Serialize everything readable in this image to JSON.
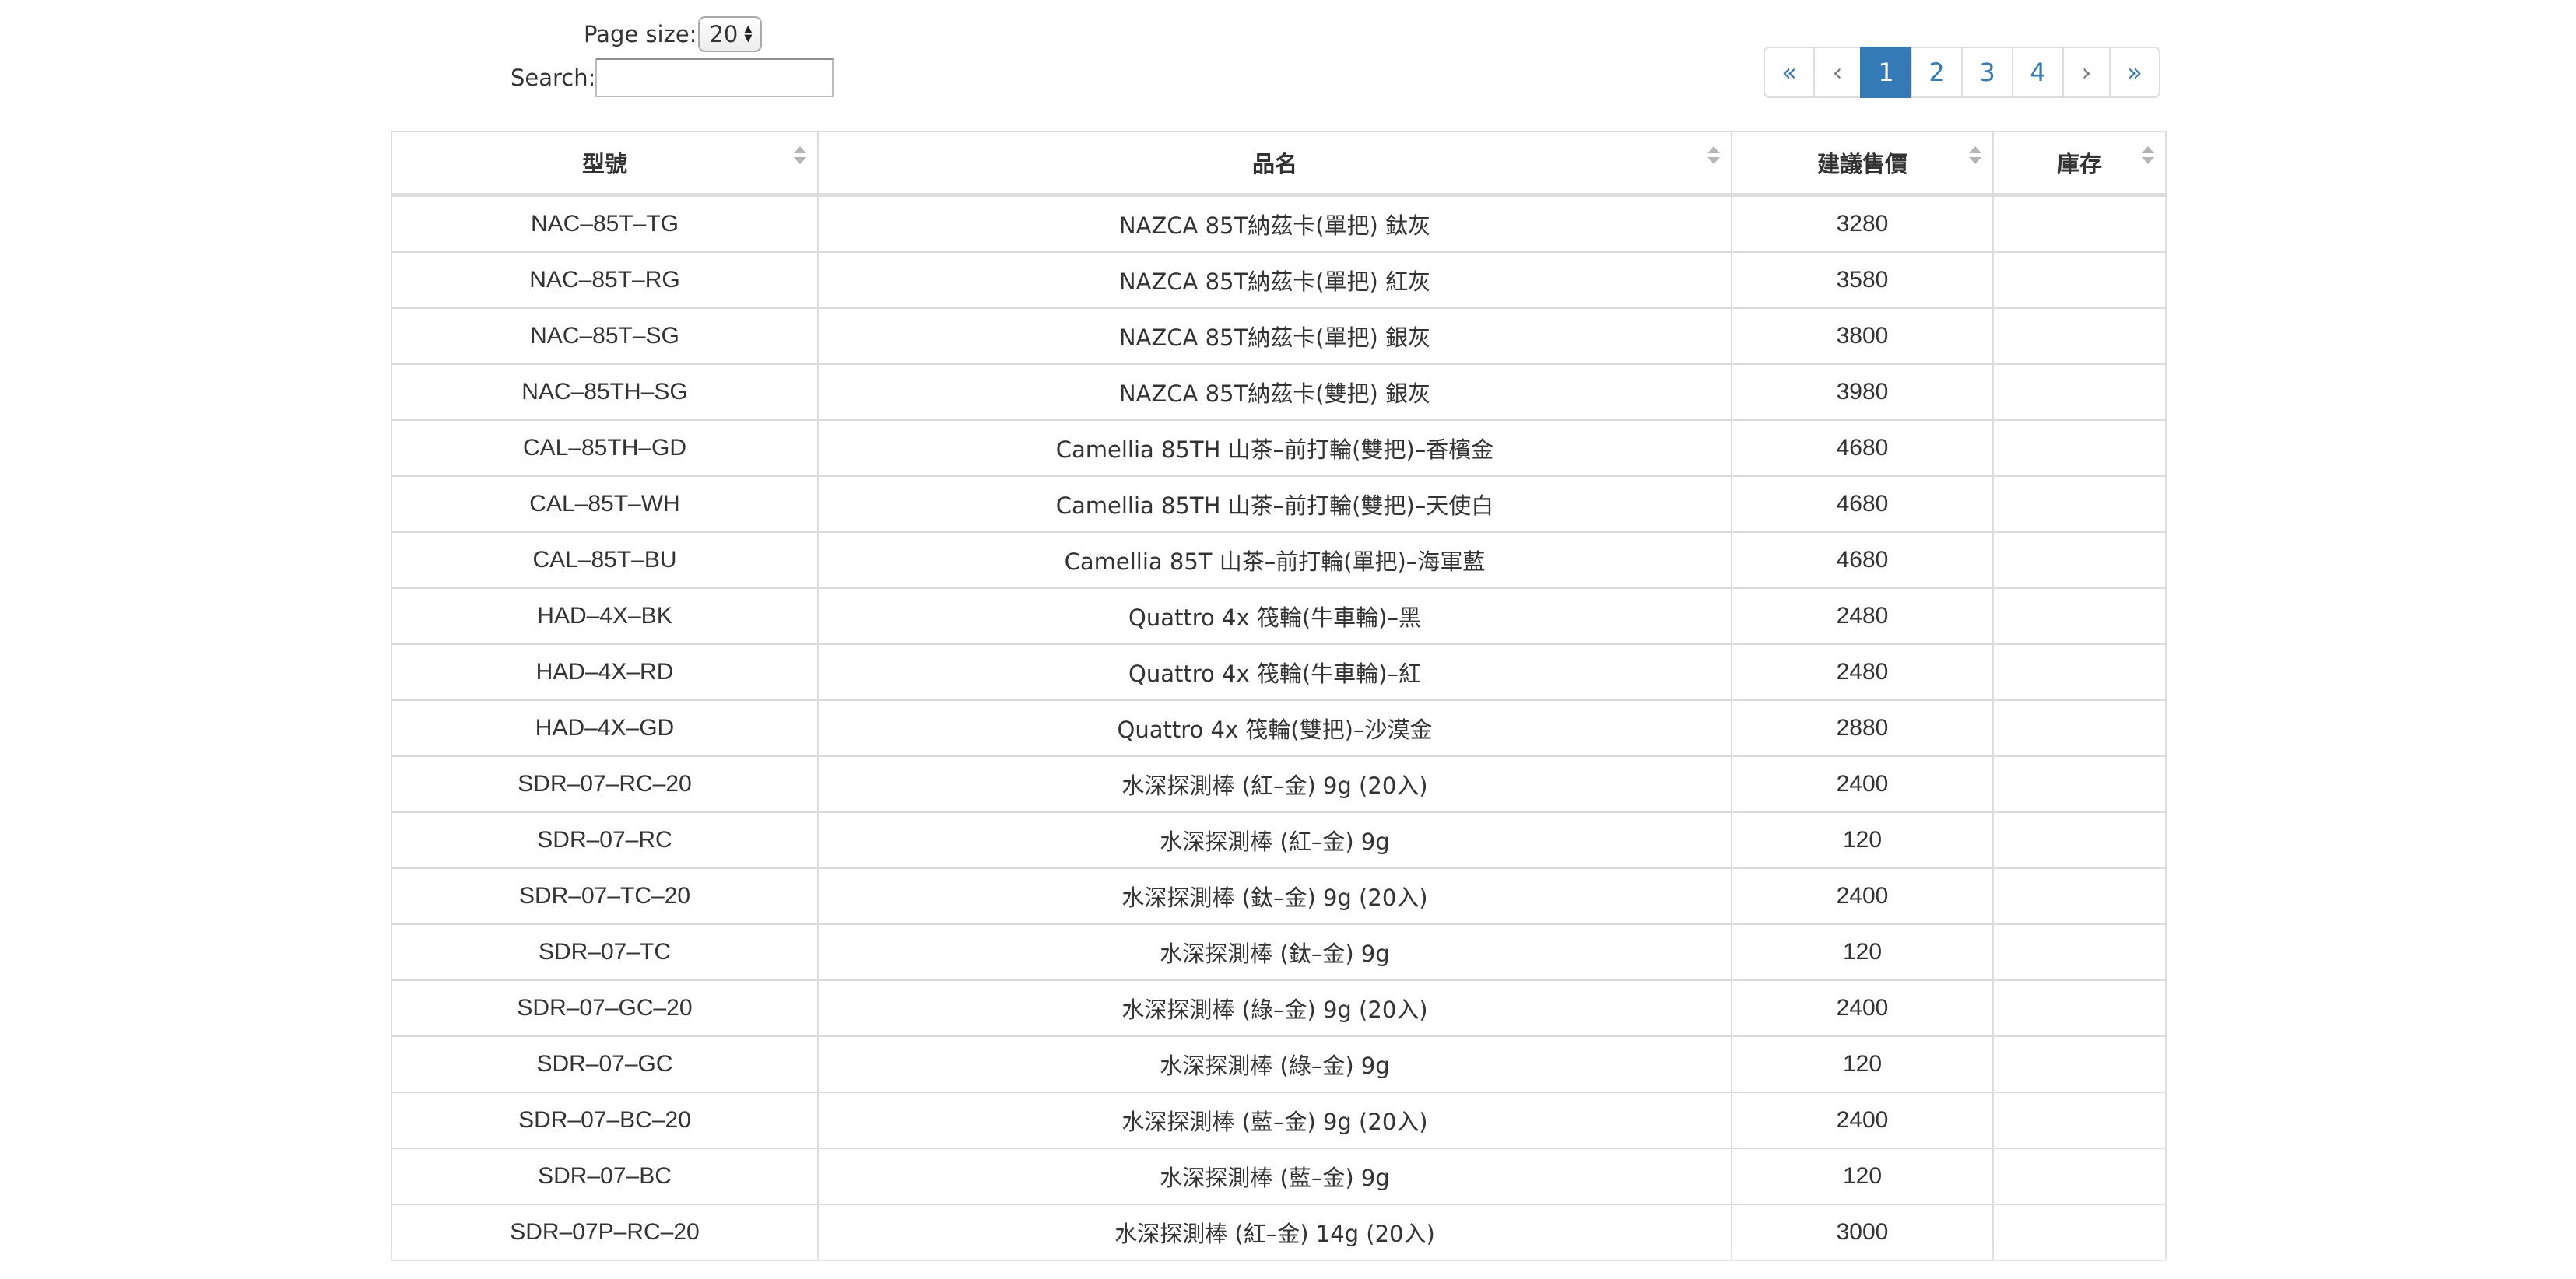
{
  "controls": {
    "page_size_label": "Page size:",
    "page_size_value": "20",
    "search_label": "Search:",
    "search_value": ""
  },
  "pagination": {
    "first": "«",
    "prev": "‹",
    "pages": [
      "1",
      "2",
      "3",
      "4"
    ],
    "active_page": "1",
    "next": "›",
    "last": "»"
  },
  "table": {
    "headers": [
      "型號",
      "品名",
      "建議售價",
      "庫存"
    ],
    "rows": [
      [
        "NAC–85T–TG",
        "NAZCA 85T納茲卡(單把) 鈦灰",
        "3280",
        ""
      ],
      [
        "NAC–85T–RG",
        "NAZCA 85T納茲卡(單把) 紅灰",
        "3580",
        ""
      ],
      [
        "NAC–85T–SG",
        "NAZCA 85T納茲卡(單把) 銀灰",
        "3800",
        ""
      ],
      [
        "NAC–85TH–SG",
        "NAZCA 85T納茲卡(雙把) 銀灰",
        "3980",
        ""
      ],
      [
        "CAL–85TH–GD",
        "Camellia 85TH 山茶–前打輪(雙把)–香檳金",
        "4680",
        ""
      ],
      [
        "CAL–85T–WH",
        "Camellia 85TH 山茶–前打輪(雙把)–天使白",
        "4680",
        ""
      ],
      [
        "CAL–85T–BU",
        "Camellia 85T 山茶–前打輪(單把)–海軍藍",
        "4680",
        ""
      ],
      [
        "HAD–4X–BK",
        "Quattro 4x 筏輪(牛車輪)–黑",
        "2480",
        ""
      ],
      [
        "HAD–4X–RD",
        "Quattro 4x 筏輪(牛車輪)–紅",
        "2480",
        ""
      ],
      [
        "HAD–4X–GD",
        "Quattro 4x 筏輪(雙把)–沙漠金",
        "2880",
        ""
      ],
      [
        "SDR–07–RC–20",
        "水深探測棒 (紅–金) 9g (20入)",
        "2400",
        ""
      ],
      [
        "SDR–07–RC",
        "水深探測棒 (紅–金) 9g",
        "120",
        ""
      ],
      [
        "SDR–07–TC–20",
        "水深探測棒 (鈦–金) 9g (20入)",
        "2400",
        ""
      ],
      [
        "SDR–07–TC",
        "水深探測棒 (鈦–金) 9g",
        "120",
        ""
      ],
      [
        "SDR–07–GC–20",
        "水深探測棒 (綠–金) 9g (20入)",
        "2400",
        ""
      ],
      [
        "SDR–07–GC",
        "水深探測棒 (綠–金) 9g",
        "120",
        ""
      ],
      [
        "SDR–07–BC–20",
        "水深探測棒 (藍–金) 9g (20入)",
        "2400",
        ""
      ],
      [
        "SDR–07–BC",
        "水深探測棒 (藍–金) 9g",
        "120",
        ""
      ],
      [
        "SDR–07P–RC–20",
        "水深探測棒 (紅–金) 14g (20入)",
        "3000",
        ""
      ]
    ]
  }
}
